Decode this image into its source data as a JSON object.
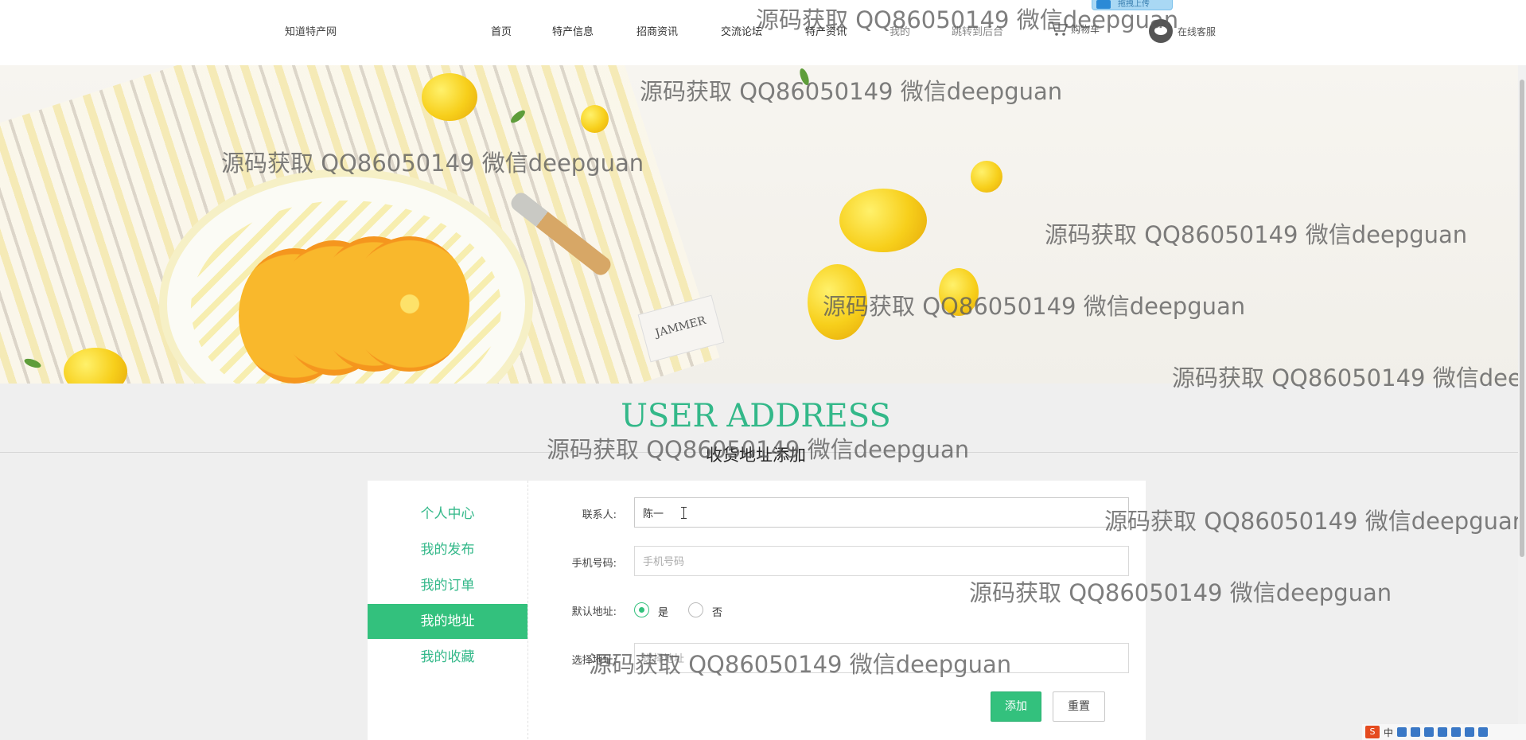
{
  "header": {
    "logo": "知道特产网",
    "nav": [
      "首页",
      "特产信息",
      "招商资讯",
      "交流论坛",
      "特产资讯",
      "我的",
      "跳转到后台"
    ],
    "cart_label": "购物车",
    "service_label": "在线客服",
    "upload_tag": "拖拽上传"
  },
  "banner": {
    "tag_text": "JAMMER"
  },
  "page": {
    "title_en": "USER ADDRESS",
    "title_cn": "收货地址添加"
  },
  "sidebar": {
    "items": [
      {
        "label": "个人中心",
        "active": false
      },
      {
        "label": "我的发布",
        "active": false
      },
      {
        "label": "我的订单",
        "active": false
      },
      {
        "label": "我的地址",
        "active": true
      },
      {
        "label": "我的收藏",
        "active": false
      }
    ]
  },
  "form": {
    "contact_label": "联系人:",
    "contact_value": "陈一",
    "phone_label": "手机号码:",
    "phone_placeholder": "手机号码",
    "default_label": "默认地址:",
    "option_yes": "是",
    "option_no": "否",
    "default_selected": "是",
    "address_label": "选择地址:",
    "address_placeholder": "选择地址",
    "submit_label": "添加",
    "reset_label": "重置"
  },
  "ime": {
    "logo": "S",
    "mode": "中"
  },
  "watermark": "源码获取 QQ86050149 微信deepguan",
  "colors": {
    "accent": "#33c17d",
    "title_green": "#33b889"
  }
}
